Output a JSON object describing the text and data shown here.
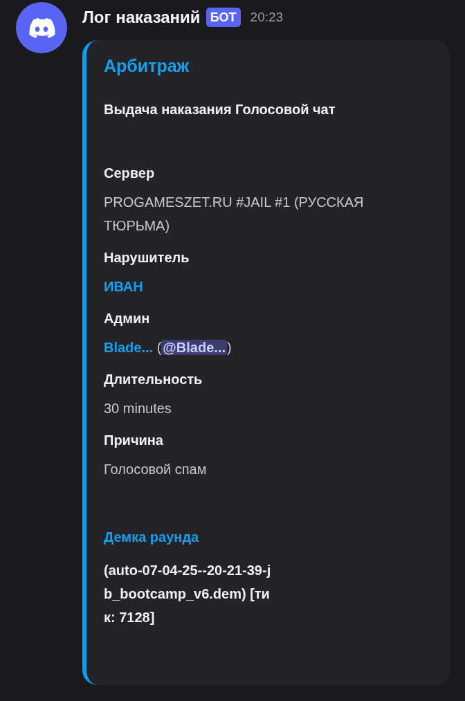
{
  "message": {
    "author": "Лог наказаний",
    "badge": "БОТ",
    "time": "20:23"
  },
  "embed": {
    "title": "Арбитраж",
    "description": "Выдача наказания Голосовой чат",
    "fields": [
      {
        "name": "Сервер",
        "value": [
          {
            "kind": "plain",
            "text": "PROGAMESZET.RU #JAIL #1 (РУССКАЯ ТЮРЬМА)"
          }
        ]
      },
      {
        "name": "Нарушитель",
        "value": [
          {
            "kind": "link",
            "text": "ИВАН"
          }
        ]
      },
      {
        "name": "Админ",
        "value": [
          {
            "kind": "link",
            "text": "Blade..."
          },
          {
            "kind": "plain",
            "text": " ("
          },
          {
            "kind": "mention",
            "text": "@Blade..."
          },
          {
            "kind": "plain",
            "text": ")"
          }
        ]
      },
      {
        "name": "Длительность",
        "value": [
          {
            "kind": "plain",
            "text": "30 minutes"
          }
        ]
      },
      {
        "name": "Причина",
        "value": [
          {
            "kind": "plain",
            "text": "Голосовой спам"
          }
        ]
      }
    ],
    "section": {
      "title": "Демка раунда",
      "text": "(auto-07-04-25--20-21-39-jb_bootcamp_v6.dem) [тик: 7128]"
    }
  }
}
